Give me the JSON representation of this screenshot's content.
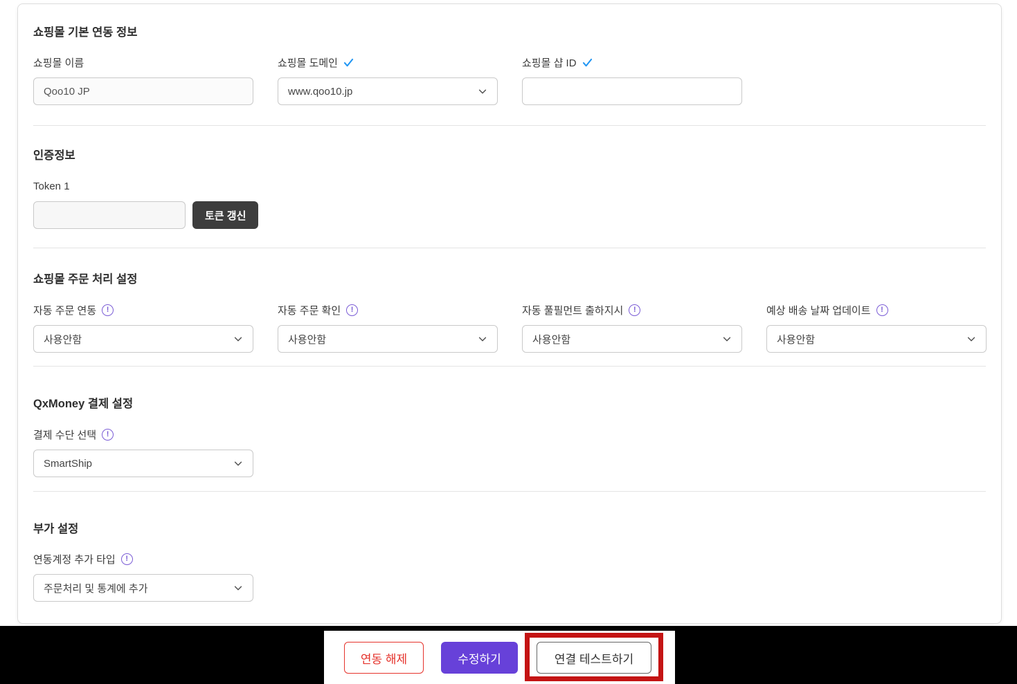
{
  "colors": {
    "accent_purple": "#6741d9",
    "info_icon_purple": "#7a5cd6",
    "verified_check_blue": "#2196f3",
    "danger_red": "#e5332c",
    "annotation_red": "#c41414",
    "token_button_dark": "#3d3d3d"
  },
  "sections": {
    "basic_info": {
      "title": "쇼핑몰 기본 연동 정보",
      "fields": [
        {
          "label": "쇼핑몰 이름",
          "value": "Qoo10 JP"
        },
        {
          "label": "쇼핑몰 도메인",
          "value": "www.qoo10.jp"
        },
        {
          "label": "쇼핑몰 샵 ID",
          "value": ""
        }
      ]
    },
    "auth": {
      "title": "인증정보",
      "token_label": "Token 1",
      "token_value": "",
      "refresh_button_label": "토큰 갱신"
    },
    "order": {
      "title": "쇼핑몰 주문 처리 설정",
      "fields": [
        {
          "label": "자동 주문 연동",
          "value": "사용안함"
        },
        {
          "label": "자동 주문 확인",
          "value": "사용안함"
        },
        {
          "label": "자동 풀필먼트 출하지시",
          "value": "사용안함"
        },
        {
          "label": "예상 배송 날짜 업데이트",
          "value": "사용안함"
        }
      ]
    },
    "payment": {
      "title": "QxMoney 결제 설정",
      "field": {
        "label": "결제 수단 선택",
        "value": "SmartShip"
      }
    },
    "extra": {
      "title": "부가 설정",
      "field": {
        "label": "연동계정 추가 타입",
        "value": "주문처리 및 통계에 추가"
      }
    }
  },
  "footer": {
    "disconnect_label": "연동 해제",
    "save_label": "수정하기",
    "test_label": "연결 테스트하기"
  }
}
